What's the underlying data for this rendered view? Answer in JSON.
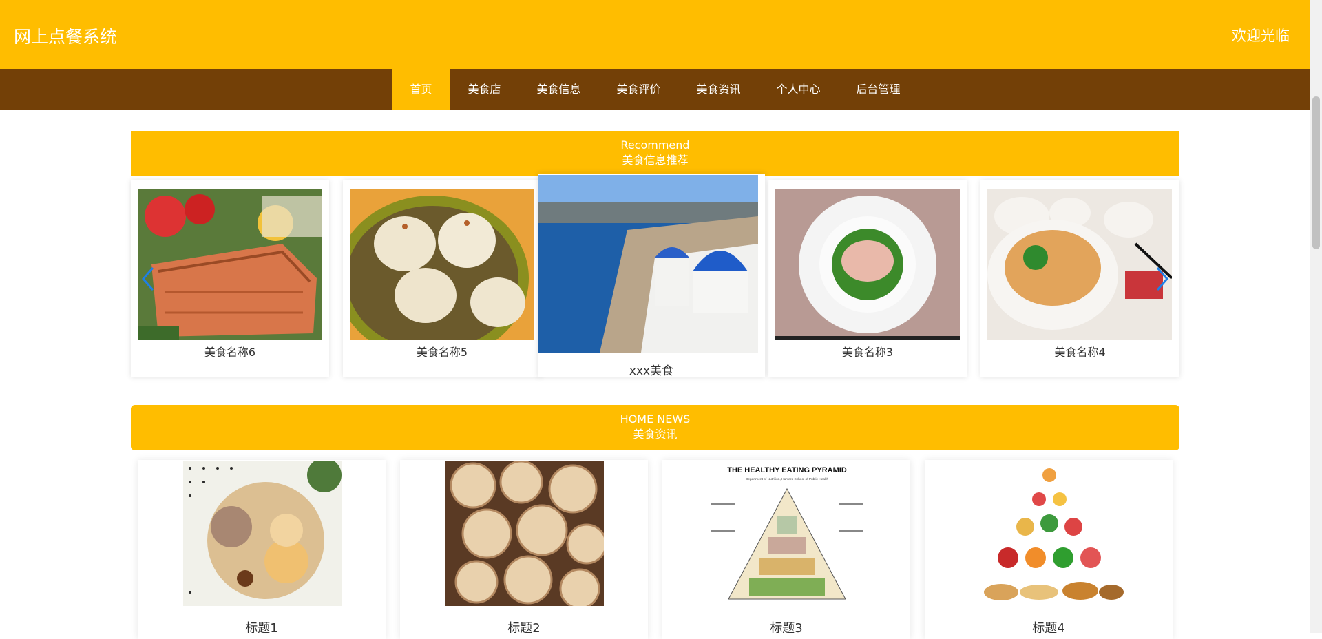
{
  "header": {
    "site_title": "网上点餐系统",
    "welcome": "欢迎光临"
  },
  "nav": {
    "items": [
      {
        "label": "首页",
        "active": true
      },
      {
        "label": "美食店",
        "active": false
      },
      {
        "label": "美食信息",
        "active": false
      },
      {
        "label": "美食评价",
        "active": false
      },
      {
        "label": "美食资讯",
        "active": false
      },
      {
        "label": "个人中心",
        "active": false
      },
      {
        "label": "后台管理",
        "active": false
      }
    ]
  },
  "recommend": {
    "title_en": "Recommend",
    "title_cn": "美食信息推荐",
    "items": [
      {
        "name": "美食名称6"
      },
      {
        "name": "美食名称5"
      },
      {
        "name": "xxx美食"
      },
      {
        "name": "美食名称3"
      },
      {
        "name": "美食名称4"
      }
    ]
  },
  "news": {
    "title_en": "HOME NEWS",
    "title_cn": "美食资讯",
    "items": [
      {
        "title": "标题1"
      },
      {
        "title": "标题2"
      },
      {
        "title": "标题3",
        "image_heading": "THE HEALTHY EATING PYRAMID",
        "image_subheading": "Department of Nutrition, Harvard School of Public Health"
      },
      {
        "title": "标题4"
      }
    ]
  },
  "colors": {
    "accent": "#FFBD00",
    "nav_bg": "#734007",
    "arrow": "#1e7fe6"
  }
}
